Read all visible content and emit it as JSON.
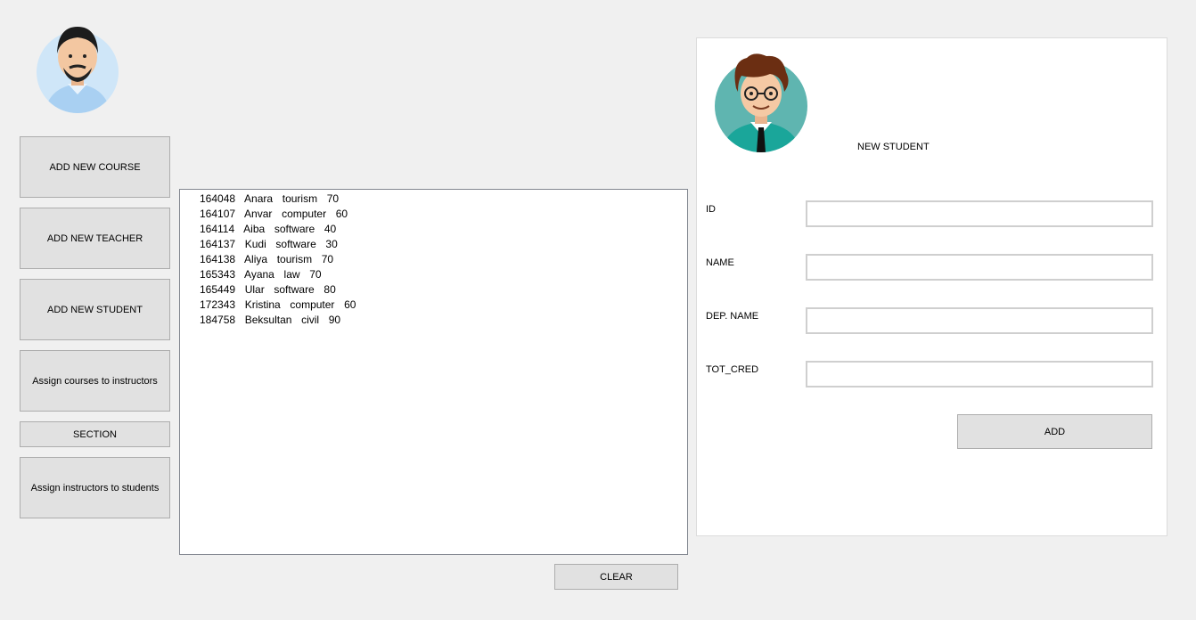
{
  "sidebar": {
    "buttons": [
      {
        "label": "ADD NEW COURSE"
      },
      {
        "label": "ADD NEW TEACHER"
      },
      {
        "label": "ADD NEW STUDENT"
      },
      {
        "label": "Assign courses to instructors"
      },
      {
        "label": "SECTION"
      },
      {
        "label": "Assign instructors to students"
      }
    ]
  },
  "list": {
    "items": [
      "164048  Anara  tourism  70",
      "164107  Anvar  computer  60",
      "164114  Aiba  software  40",
      "164137  Kudi  software  30",
      "164138  Aliya  tourism  70",
      "165343  Ayana  law  70",
      "165449  Ular  software  80",
      "172343  Kristina  computer  60",
      "184758  Beksultan  civil  90"
    ],
    "clear_label": "CLEAR"
  },
  "form": {
    "title": "NEW STUDENT",
    "fields": [
      {
        "label": "ID",
        "value": ""
      },
      {
        "label": "NAME",
        "value": ""
      },
      {
        "label": "DEP. NAME",
        "value": ""
      },
      {
        "label": "TOT_CRED",
        "value": ""
      }
    ],
    "add_label": "ADD"
  },
  "icons": {
    "admin_avatar": "bearded-man-avatar-icon",
    "student_avatar": "student-with-glasses-avatar-icon"
  },
  "colors": {
    "admin_avatar_bg": "#cfe6f8",
    "student_avatar_bg": "#5fb5b0",
    "shirt_teal": "#1aa69a"
  }
}
